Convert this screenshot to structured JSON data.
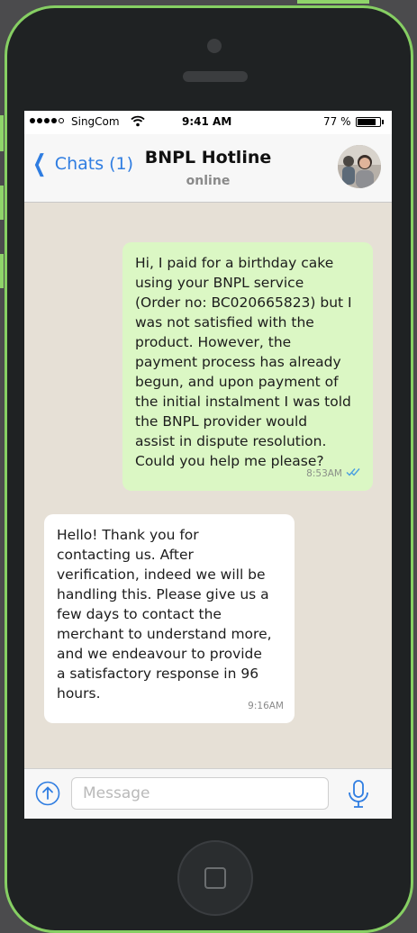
{
  "status_bar": {
    "carrier": "SingCom",
    "time": "9:41 AM",
    "battery": "77 %"
  },
  "header": {
    "back_label": "Chats (1)",
    "title": "BNPL Hotline",
    "subtitle": "online"
  },
  "messages": [
    {
      "direction": "outgoing",
      "text": "Hi, I paid for a birthday cake\nusing your BNPL service\n(Order no: BC020665823) but I\nwas not satisfied with the\nproduct. However, the\npayment process has already\nbegun, and upon payment of\nthe initial instalment I was told\nthe BNPL provider would\nassist in dispute resolution.\nCould you help me please?",
      "time": "8:53AM",
      "read": true
    },
    {
      "direction": "incoming",
      "text": "Hello! Thank you for\ncontacting us. After\nverification, indeed we will be\nhandling this. Please give us a\nfew days to contact the\nmerchant to understand more,\nand we endeavour to provide\na satisfactory response in 96\nhours.",
      "time": "9:16AM"
    }
  ],
  "composer": {
    "placeholder": "Message",
    "value": ""
  },
  "icons": {
    "wifi": "wifi-icon",
    "battery": "battery-icon",
    "back": "chevron-left-icon",
    "read": "double-check-icon",
    "attach": "upload-arrow-icon",
    "mic": "microphone-icon"
  },
  "colors": {
    "accent": "#2f7de1",
    "outgoing_bubble": "#dbf7c4",
    "incoming_bubble": "#ffffff",
    "frame_accent": "#86cf63",
    "chat_background": "#e6e0d6"
  }
}
